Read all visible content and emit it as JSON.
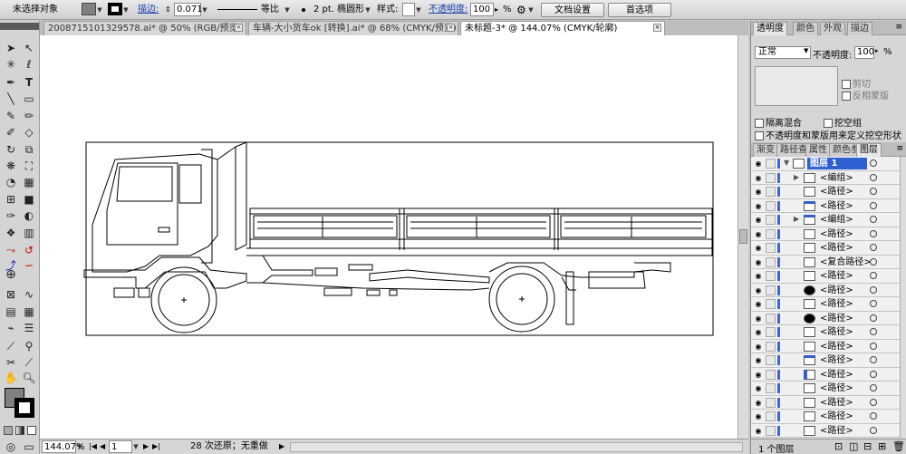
{
  "control_bar": {
    "selection_label": "未选择对象",
    "stroke_label": "描边:",
    "stroke_width": "0.071",
    "proportion_label": "等比",
    "brush_label": "2 pt. 椭圆形",
    "style_label": "样式:",
    "opacity_label": "不透明度:",
    "opacity_value": "100",
    "opacity_unit": "%",
    "doc_setup_button": "文档设置",
    "preferences_button": "首选项"
  },
  "document_tabs": [
    {
      "label": "2008715101329578.ai* @ 50% (RGB/预览)"
    },
    {
      "label": "车辆-大小货车ok [转换].ai* @ 68% (CMYK/预览)"
    },
    {
      "label": "未标题-3* @ 144.07% (CMYK/轮廓)",
      "active": true
    }
  ],
  "status_bar": {
    "zoom": "144.07%",
    "page": "1",
    "history": "28 次还原；无重做"
  },
  "transparency_panel": {
    "tabs": [
      "透明度",
      "颜色",
      "外观",
      "描边"
    ],
    "blend_mode": "正常",
    "opacity_label": "不透明度:",
    "opacity_value": "100",
    "opacity_unit": "%",
    "clip_label": "剪切",
    "invert_mask_label": "反相蒙版",
    "isolate_blending_label": "隔离混合",
    "knockout_group_label": "挖空组",
    "opacity_mask_define_label": "不透明度和蒙版用来定义挖空形状"
  },
  "layers_panel": {
    "tabs": [
      "渐变",
      "路径查",
      "属性",
      "颜色参",
      "图层"
    ],
    "layers": [
      {
        "name": "图层 1",
        "level": 0,
        "thumb": "layer"
      },
      {
        "name": "<编组>",
        "level": 1,
        "thumb": "plain"
      },
      {
        "name": "<路径>",
        "level": 1,
        "thumb": "plain"
      },
      {
        "name": "<路径>",
        "level": 1,
        "thumb": "bar"
      },
      {
        "name": "<编组>",
        "level": 1,
        "thumb": "bar"
      },
      {
        "name": "<路径>",
        "level": 1,
        "thumb": "plain"
      },
      {
        "name": "<路径>",
        "level": 1,
        "thumb": "plain"
      },
      {
        "name": "<复合路径>",
        "level": 1,
        "thumb": "plain"
      },
      {
        "name": "<路径>",
        "level": 1,
        "thumb": "plain"
      },
      {
        "name": "<路径>",
        "level": 1,
        "thumb": "blob"
      },
      {
        "name": "<路径>",
        "level": 1,
        "thumb": "plain"
      },
      {
        "name": "<路径>",
        "level": 1,
        "thumb": "blob"
      },
      {
        "name": "<路径>",
        "level": 1,
        "thumb": "plain"
      },
      {
        "name": "<路径>",
        "level": 1,
        "thumb": "plain"
      },
      {
        "name": "<路径>",
        "level": 1,
        "thumb": "bar"
      },
      {
        "name": "<路径>",
        "level": 1,
        "thumb": "sliver"
      },
      {
        "name": "<路径>",
        "level": 1,
        "thumb": "plain"
      },
      {
        "name": "<路径>",
        "level": 1,
        "thumb": "plain"
      },
      {
        "name": "<路径>",
        "level": 1,
        "thumb": "plain"
      },
      {
        "name": "<路径>",
        "level": 1,
        "thumb": "plain"
      }
    ],
    "footer": "1 个图层"
  },
  "colors": {
    "accent": "#3f66d8",
    "selected_layer": "#2f5fd0"
  }
}
